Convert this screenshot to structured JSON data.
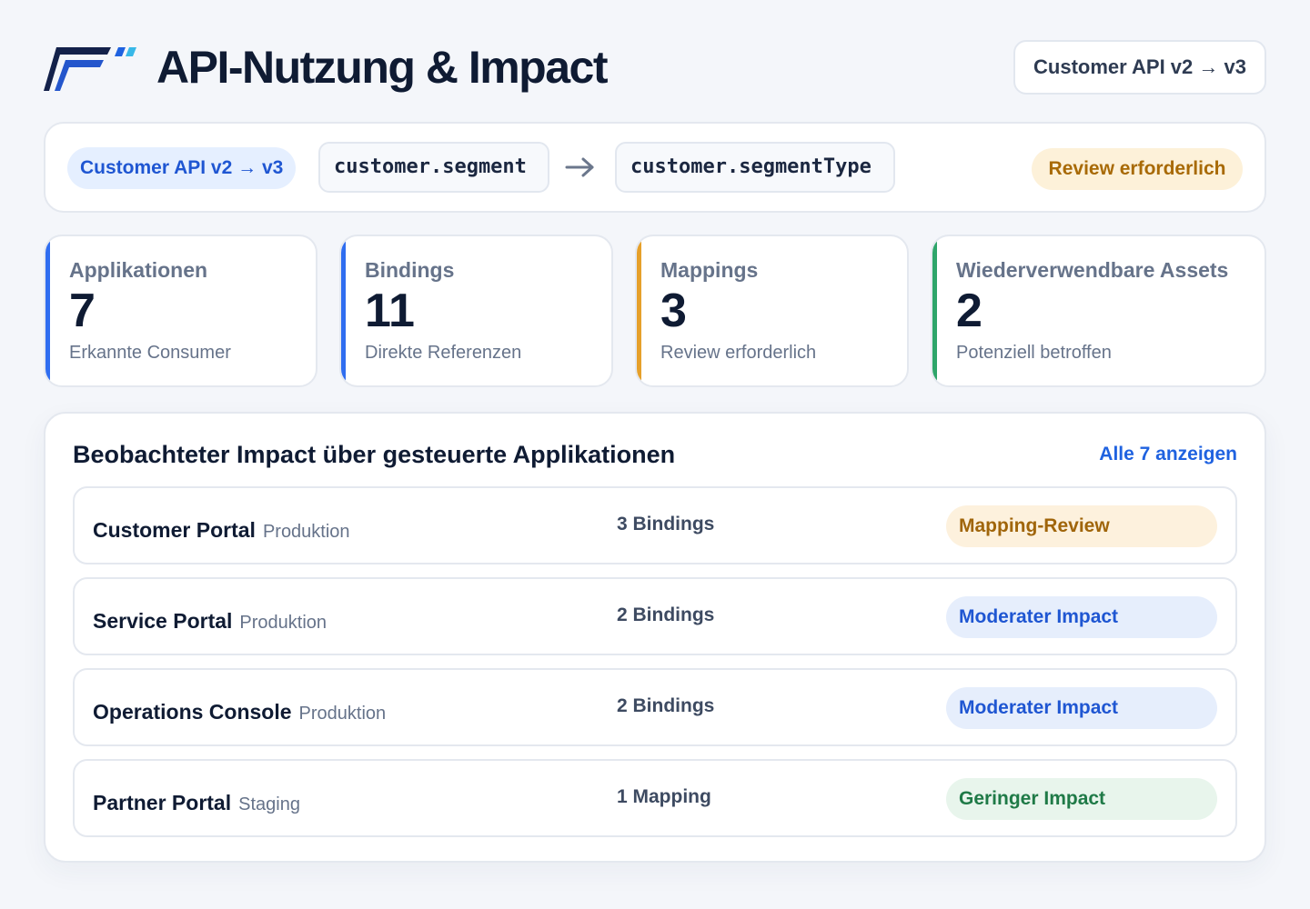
{
  "header": {
    "title": "API-Nutzung & Impact",
    "version_label": "Customer API v2 → v3"
  },
  "field_change": {
    "api_label": "Customer API v2 → v3",
    "old_field": "customer.segment",
    "new_field": "customer.segmentType",
    "status_label": "Review erforderlich"
  },
  "stats": [
    {
      "label": "Applikationen",
      "value": "7",
      "sub": "Erkannte Consumer",
      "accent": "#2f6df0"
    },
    {
      "label": "Bindings",
      "value": "11",
      "sub": "Direkte Referenzen",
      "accent": "#2f6df0"
    },
    {
      "label": "Mappings",
      "value": "3",
      "sub": "Review erforderlich",
      "accent": "#e6a02a"
    },
    {
      "label": "Wiederverwendbare Assets",
      "value": "2",
      "sub": "Potenziell betroffen",
      "accent": "#2ea56a"
    }
  ],
  "impact": {
    "title": "Beobachteter Impact über gesteuerte Applikationen",
    "link_label": "Alle 7 anzeigen",
    "rows": [
      {
        "name": "Customer Portal",
        "env": "Produktion",
        "count": "3 Bindings",
        "badge": "Mapping-Review",
        "level": "review"
      },
      {
        "name": "Service Portal",
        "env": "Produktion",
        "count": "2 Bindings",
        "badge": "Moderater Impact",
        "level": "moderate"
      },
      {
        "name": "Operations Console",
        "env": "Produktion",
        "count": "2 Bindings",
        "badge": "Moderater Impact",
        "level": "moderate"
      },
      {
        "name": "Partner Portal",
        "env": "Staging",
        "count": "1 Mapping",
        "badge": "Geringer Impact",
        "level": "low"
      }
    ]
  },
  "icons": {
    "logo": "brand-logo-icon",
    "arrow": "arrow-right-icon"
  }
}
